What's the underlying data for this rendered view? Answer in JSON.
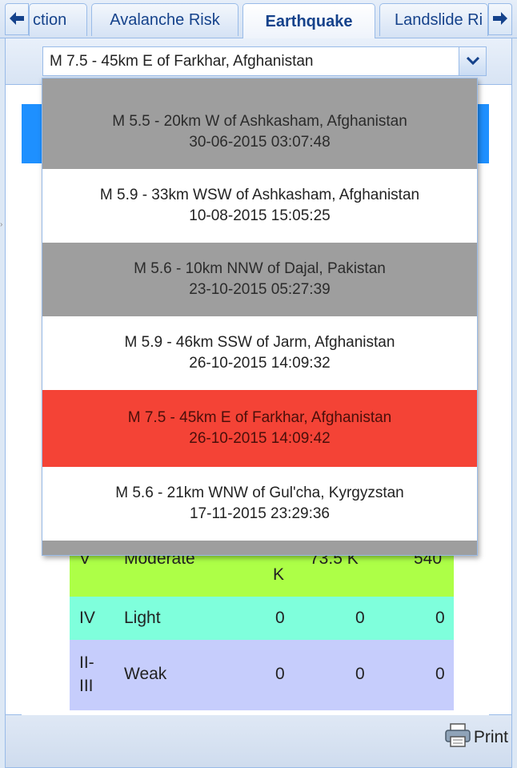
{
  "tabs": [
    {
      "label": "ction"
    },
    {
      "label": "Avalanche Risk"
    },
    {
      "label": "Earthquake"
    },
    {
      "label": "Landslide Ri"
    }
  ],
  "combo": {
    "value": "M 7.5 - 45km E of Farkhar, Afghanistan"
  },
  "dropdown_items": [
    {
      "title": "M 5.5 - 20km W of Ashkasham, Afghanistan",
      "date": "30-06-2015 03:07:48",
      "style": "gray"
    },
    {
      "title": "M 5.9 - 33km WSW of Ashkasham, Afghanistan",
      "date": "10-08-2015 15:05:25",
      "style": "white"
    },
    {
      "title": "M 5.6 - 10km NNW of Dajal, Pakistan",
      "date": "23-10-2015 05:27:39",
      "style": "gray"
    },
    {
      "title": "M 5.9 - 46km SSW of Jarm, Afghanistan",
      "date": "26-10-2015 14:09:32",
      "style": "white"
    },
    {
      "title": "M 7.5 - 45km E of Farkhar, Afghanistan",
      "date": "26-10-2015 14:09:42",
      "style": "selected"
    },
    {
      "title": "M 5.6 - 21km WNW of Gul'cha, Kyrgyzstan",
      "date": "17-11-2015 23:29:36",
      "style": "white"
    }
  ],
  "intensity_table": [
    {
      "level": "V",
      "desc": "Moderate",
      "col1": "K",
      "col2": "73.5 K",
      "col3": "540",
      "color": "#adff47"
    },
    {
      "level": "IV",
      "desc": "Light",
      "col1": "0",
      "col2": "0",
      "col3": "0",
      "color": "#7fffdc"
    },
    {
      "level": "II-III",
      "level_line1": "II-",
      "level_line2": "III",
      "desc": "Weak",
      "col1": "0",
      "col2": "0",
      "col3": "0",
      "color": "#c6cdfc"
    }
  ],
  "footer": {
    "print_label": "Print"
  },
  "colors": {
    "accent_blue": "#1e90ff",
    "selected_item": "#f44336",
    "alt_item_gray": "#9e9e9e"
  }
}
